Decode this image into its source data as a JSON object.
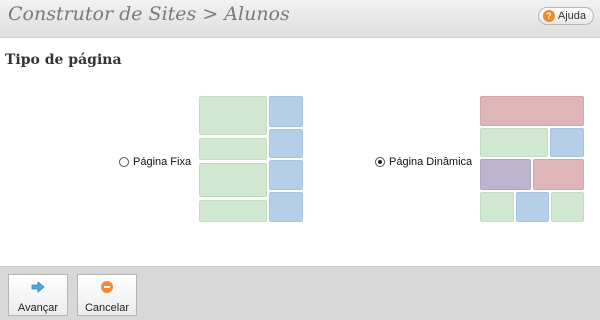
{
  "header": {
    "title": "Construtor de Sites > Alunos",
    "help_label": "Ajuda",
    "help_icon": "?"
  },
  "section": {
    "title": "Tipo de página"
  },
  "options": {
    "fixed": {
      "label": "Página Fixa",
      "selected": false
    },
    "dynamic": {
      "label": "Página Dinâmica",
      "selected": true
    }
  },
  "footer": {
    "next_label": "Avançar",
    "cancel_label": "Cancelar",
    "next_icon": "arrow-right-icon",
    "cancel_icon": "minus-circle-icon"
  },
  "colors": {
    "green": "#d1e8d0",
    "blue": "#b6cfe8",
    "red": "#dfb6b8",
    "purple": "#bdb3cf"
  }
}
